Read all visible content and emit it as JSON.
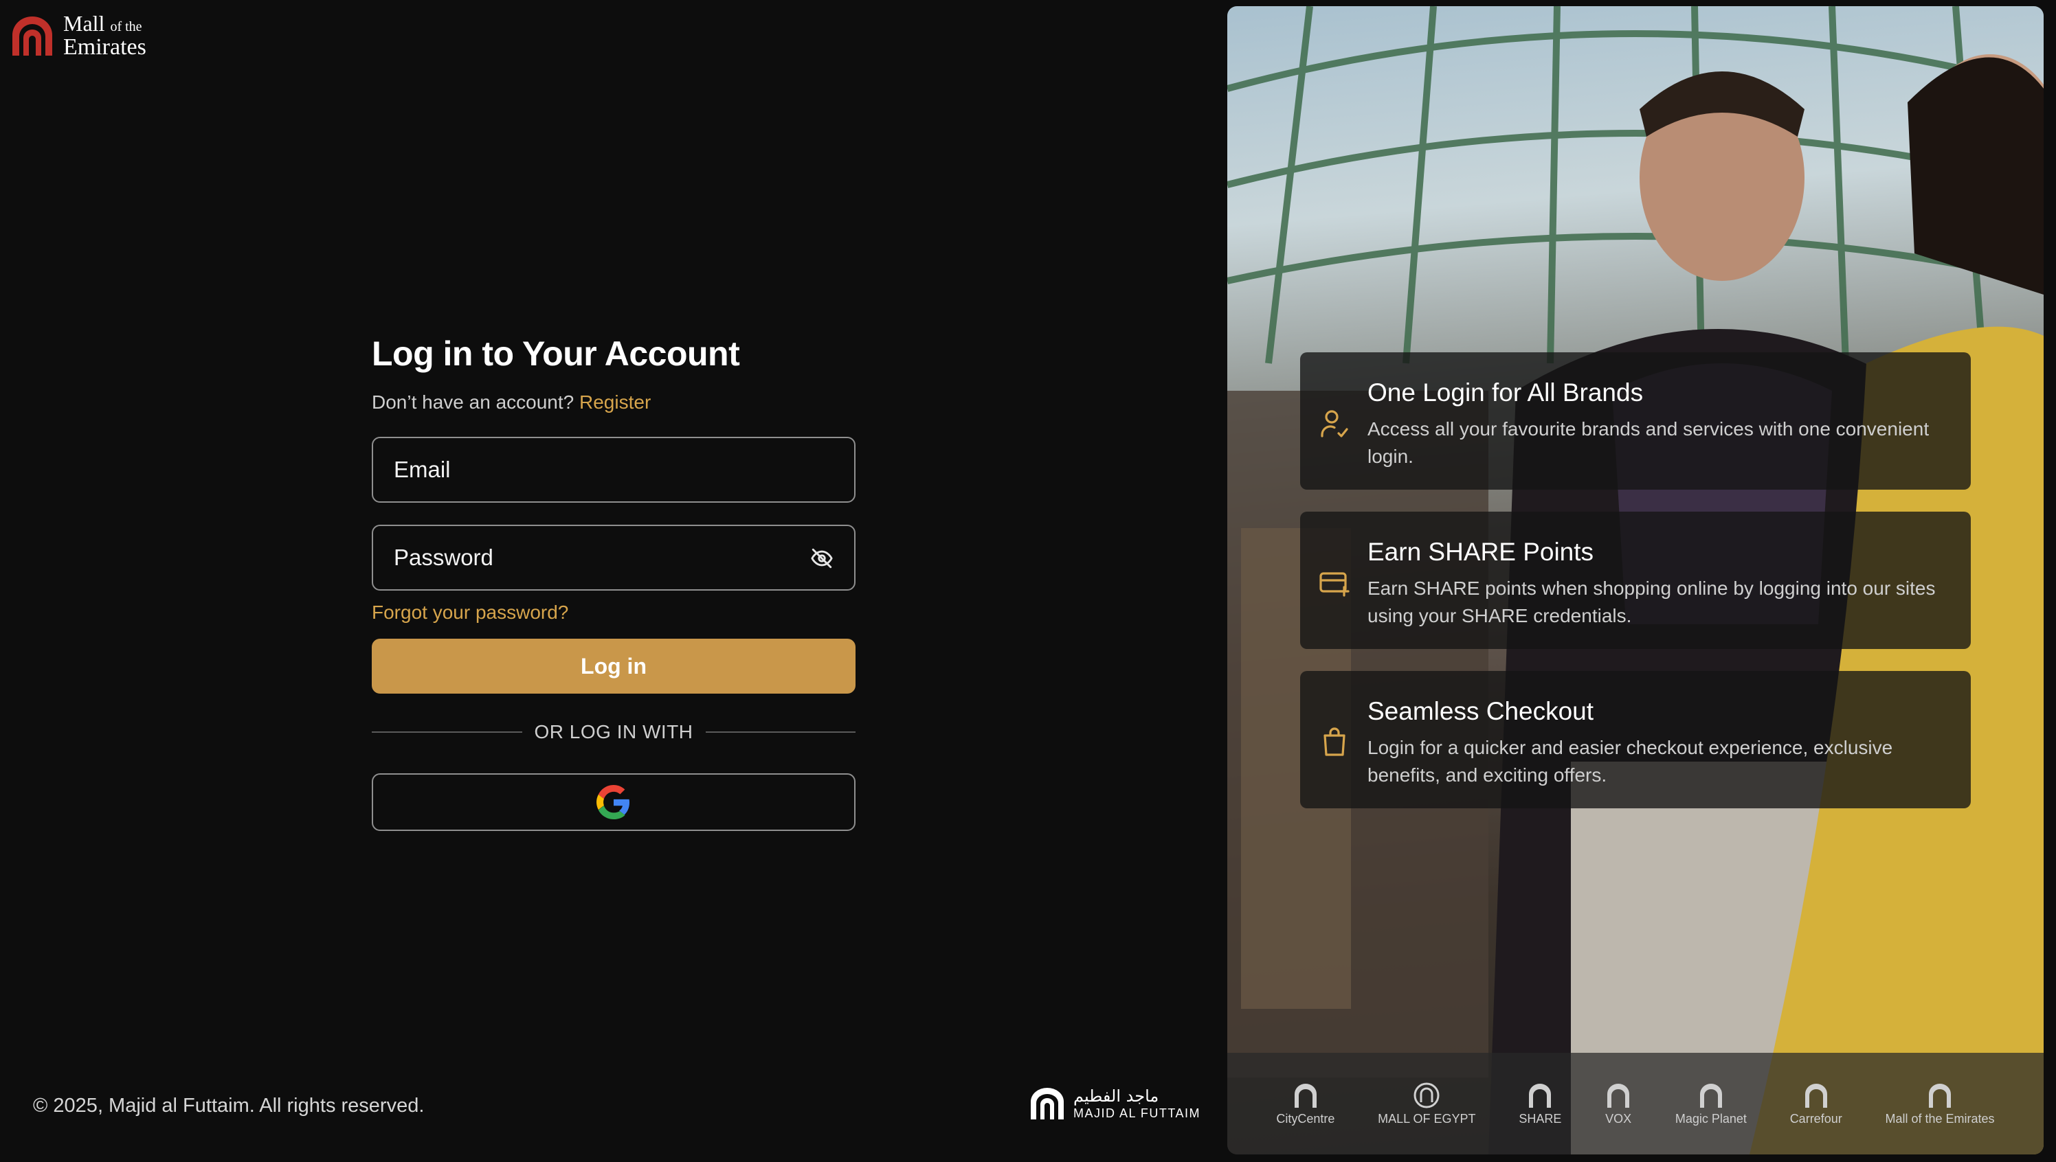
{
  "logo": {
    "name_line1": "Mall",
    "name_line1_small": "of the",
    "name_line2": "Emirates",
    "icon": "mall-arch-logo-icon",
    "brand_color": "#c0302a"
  },
  "form": {
    "title": "Log in to Your Account",
    "register_prompt": "Don’t have an account?",
    "register_link": "Register",
    "email_placeholder": "Email",
    "password_placeholder": "Password",
    "password_toggle_icon": "eye-off-icon",
    "forgot_link": "Forgot your password?",
    "login_button": "Log in",
    "divider_text": "OR LOG IN WITH",
    "google_icon": "google-icon",
    "accent_color": "#c9974a"
  },
  "footer": {
    "copyright": "© 2025, Majid al Futtaim. All rights reserved.",
    "maf_arabic": "ماجد الفطيم",
    "maf_english": "MAJID AL FUTTAIM"
  },
  "features": [
    {
      "icon": "user-check-icon",
      "title": "One Login for All Brands",
      "description": "Access all your favourite brands and services with one convenient login."
    },
    {
      "icon": "card-plus-icon",
      "title": "Earn SHARE Points",
      "description": "Earn SHARE points when shopping online by logging into our sites using your SHARE credentials."
    },
    {
      "icon": "shopping-bag-icon",
      "title": "Seamless Checkout",
      "description": "Login for a quicker and easier checkout experience, exclusive benefits, and exciting offers."
    }
  ],
  "brands": [
    "CityCentre",
    "MALL OF EGYPT",
    "SHARE",
    "VOX",
    "Magic Planet",
    "Carrefour",
    "Mall of the Emirates"
  ]
}
